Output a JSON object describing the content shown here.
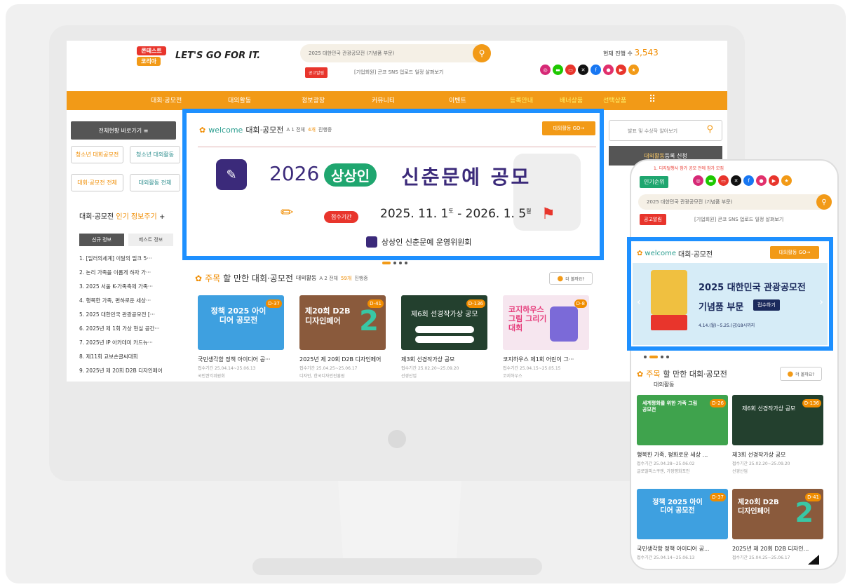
{
  "site": {
    "logo_line1": "콘테스트",
    "logo_line2": "코리아",
    "slogan": "LET'S GO FOR IT.",
    "search_placeholder": "2025 대한민국 관광공모전 (기념품 부문)",
    "notice_badge": "공고알림",
    "notice_text": "[기업회원] 콘코 SNS 업로드 일정 살펴보기",
    "current_count_label": "현재 진행 수",
    "current_count_value": "3,543"
  },
  "nav": [
    "대회·공모전",
    "대외활동",
    "정보광장",
    "커뮤니티",
    "이벤트",
    "등록안내",
    "배너상품",
    "선택상품"
  ],
  "sidebar": {
    "shortcut": "전체현황 바로가기 ≡",
    "quick": [
      "청소년 대회공모전",
      "청소년 대외활동",
      "대회·공모전 전체",
      "대외활동 전체"
    ],
    "popular_title": "대회·공모전",
    "popular_title_accent": "인기 정보주기",
    "tabs": [
      "신규 정보",
      "베스트 정보"
    ],
    "items": [
      "1. [일러의세계] 이달의 밀크 5···",
      "2. 논리 가족을 이롭게 하자 가···",
      "3. 2025 서울 K-가족축제 가족···",
      "4. 행복한 가족, 편하로운 세상···",
      "5. 2025 대한민국 관광공모전 [···",
      "6. 2025년 제 1회 가상 현실 공간···",
      "7. 2025년 IP 아카데미 카드뉴···",
      "8. 제11회 교보손글씨대회",
      "9. 2025년 제 20회 D2B 디자인페어"
    ]
  },
  "welcome": {
    "welcome_word": "welcome",
    "section": "대회·공모전",
    "sub": "A 1 전체",
    "sub_accent": "4개",
    "sub_tail": "진행중",
    "button": "대외활동 GO→"
  },
  "hero": {
    "year": "2026",
    "badge": "상상인",
    "title": "신춘문예 공모",
    "period_badge": "접수기간",
    "period": "2025. 11. 1",
    "period_dow1": "토",
    "period_end": " - 2026. 1. 5",
    "period_dow2": "월",
    "org": "상상인 신춘문예 운영위원회"
  },
  "featured": {
    "accent": "주목",
    "title": "할 만한 대회·공모전",
    "category": "대외활동",
    "sub": "A 2 전체",
    "sub_accent": "59개",
    "sub_tail": "진행중",
    "more_button": "더 볼까요?"
  },
  "cards": [
    {
      "title": "국민생각함 정책 아이디어 공···",
      "meta1": "접수기간 25.04.14~25.06.13",
      "meta2": "국민권익위원회",
      "dday": "D-37",
      "img_text": "정책 2025 아이디어 공모전"
    },
    {
      "title": "2025년 제 20회 D2B 디자인페어",
      "meta1": "접수기간 25.04.25~25.06.17",
      "meta2": "디자인, 한국디자인진흥원",
      "dday": "D-41",
      "img_text": "제20회 D2B 디자인페어"
    },
    {
      "title": "제3회 선경작가상 공모",
      "meta1": "접수기간 25.02.20~25.09.20",
      "meta2": "선경산업",
      "dday": "D-136",
      "img_text": "제6회 선경작가상 공모"
    },
    {
      "title": "코지하우스 제1회 어린이 그···",
      "meta1": "접수기간 25.04.15~25.05.15",
      "meta2": "코지하우스",
      "dday": "D-8",
      "img_text": "코지하우스 그림 그리기 대회"
    }
  ],
  "right": {
    "search_placeholder": "발표 및 수상작 알아보기",
    "register_button_accent": "대외활동",
    "register_button": "등록 신청"
  },
  "mobile": {
    "popular_badge": "인기순위",
    "top_hint": "1. 디지털행사 참가 공모 전에 참가 모집",
    "search_placeholder": "2025 대한민국 관광공모전 (기념품 부문)",
    "notice_badge": "공고알림",
    "notice_text": "[기업회원] 콘코 SNS 업로드 일정 살펴보기",
    "welcome_word": "welcome",
    "section": "대회·공모전",
    "go_button": "대외활동 GO→",
    "banner_title1": "2025 대한민국 관광공모전",
    "banner_title2": "기념품 부문",
    "banner_button": "접수하기",
    "banner_dates": "4.14.(월)~5.25.(금)18시까지",
    "featured_accent": "주목",
    "featured_title": "할 만한 대회·공모전",
    "featured_category": "대외활동",
    "more_button": "더 볼까요?",
    "cards": [
      {
        "title": "행복한 가족, 평화로운 세상 ...",
        "meta": "접수기간 25.04.28~25.06.02",
        "meta2": "글로벌피스쿠엔, 가정평화포인",
        "dday": "D-26",
        "img_text": "세계평화를 위한 가족 그림 공모전"
      },
      {
        "title": "제3회 선경작가상 공모",
        "meta": "접수기간 25.02.20~25.09.20",
        "meta2": "선경산업",
        "dday": "D-136",
        "img_text": "제6회 선경작가상 공모"
      },
      {
        "title": "국민생각함 정책 아이디어 공...",
        "meta": "접수기간 25.04.14~25.06.13",
        "meta2": "",
        "dday": "D-37",
        "img_text": "정책 2025 아이디어 공모전"
      },
      {
        "title": "2025년 제 20회 D2B 디자인...",
        "meta": "접수기간 25.04.25~25.06.17",
        "meta2": "",
        "dday": "D-41",
        "img_text": "제20회 D2B 디자인페어"
      }
    ]
  }
}
